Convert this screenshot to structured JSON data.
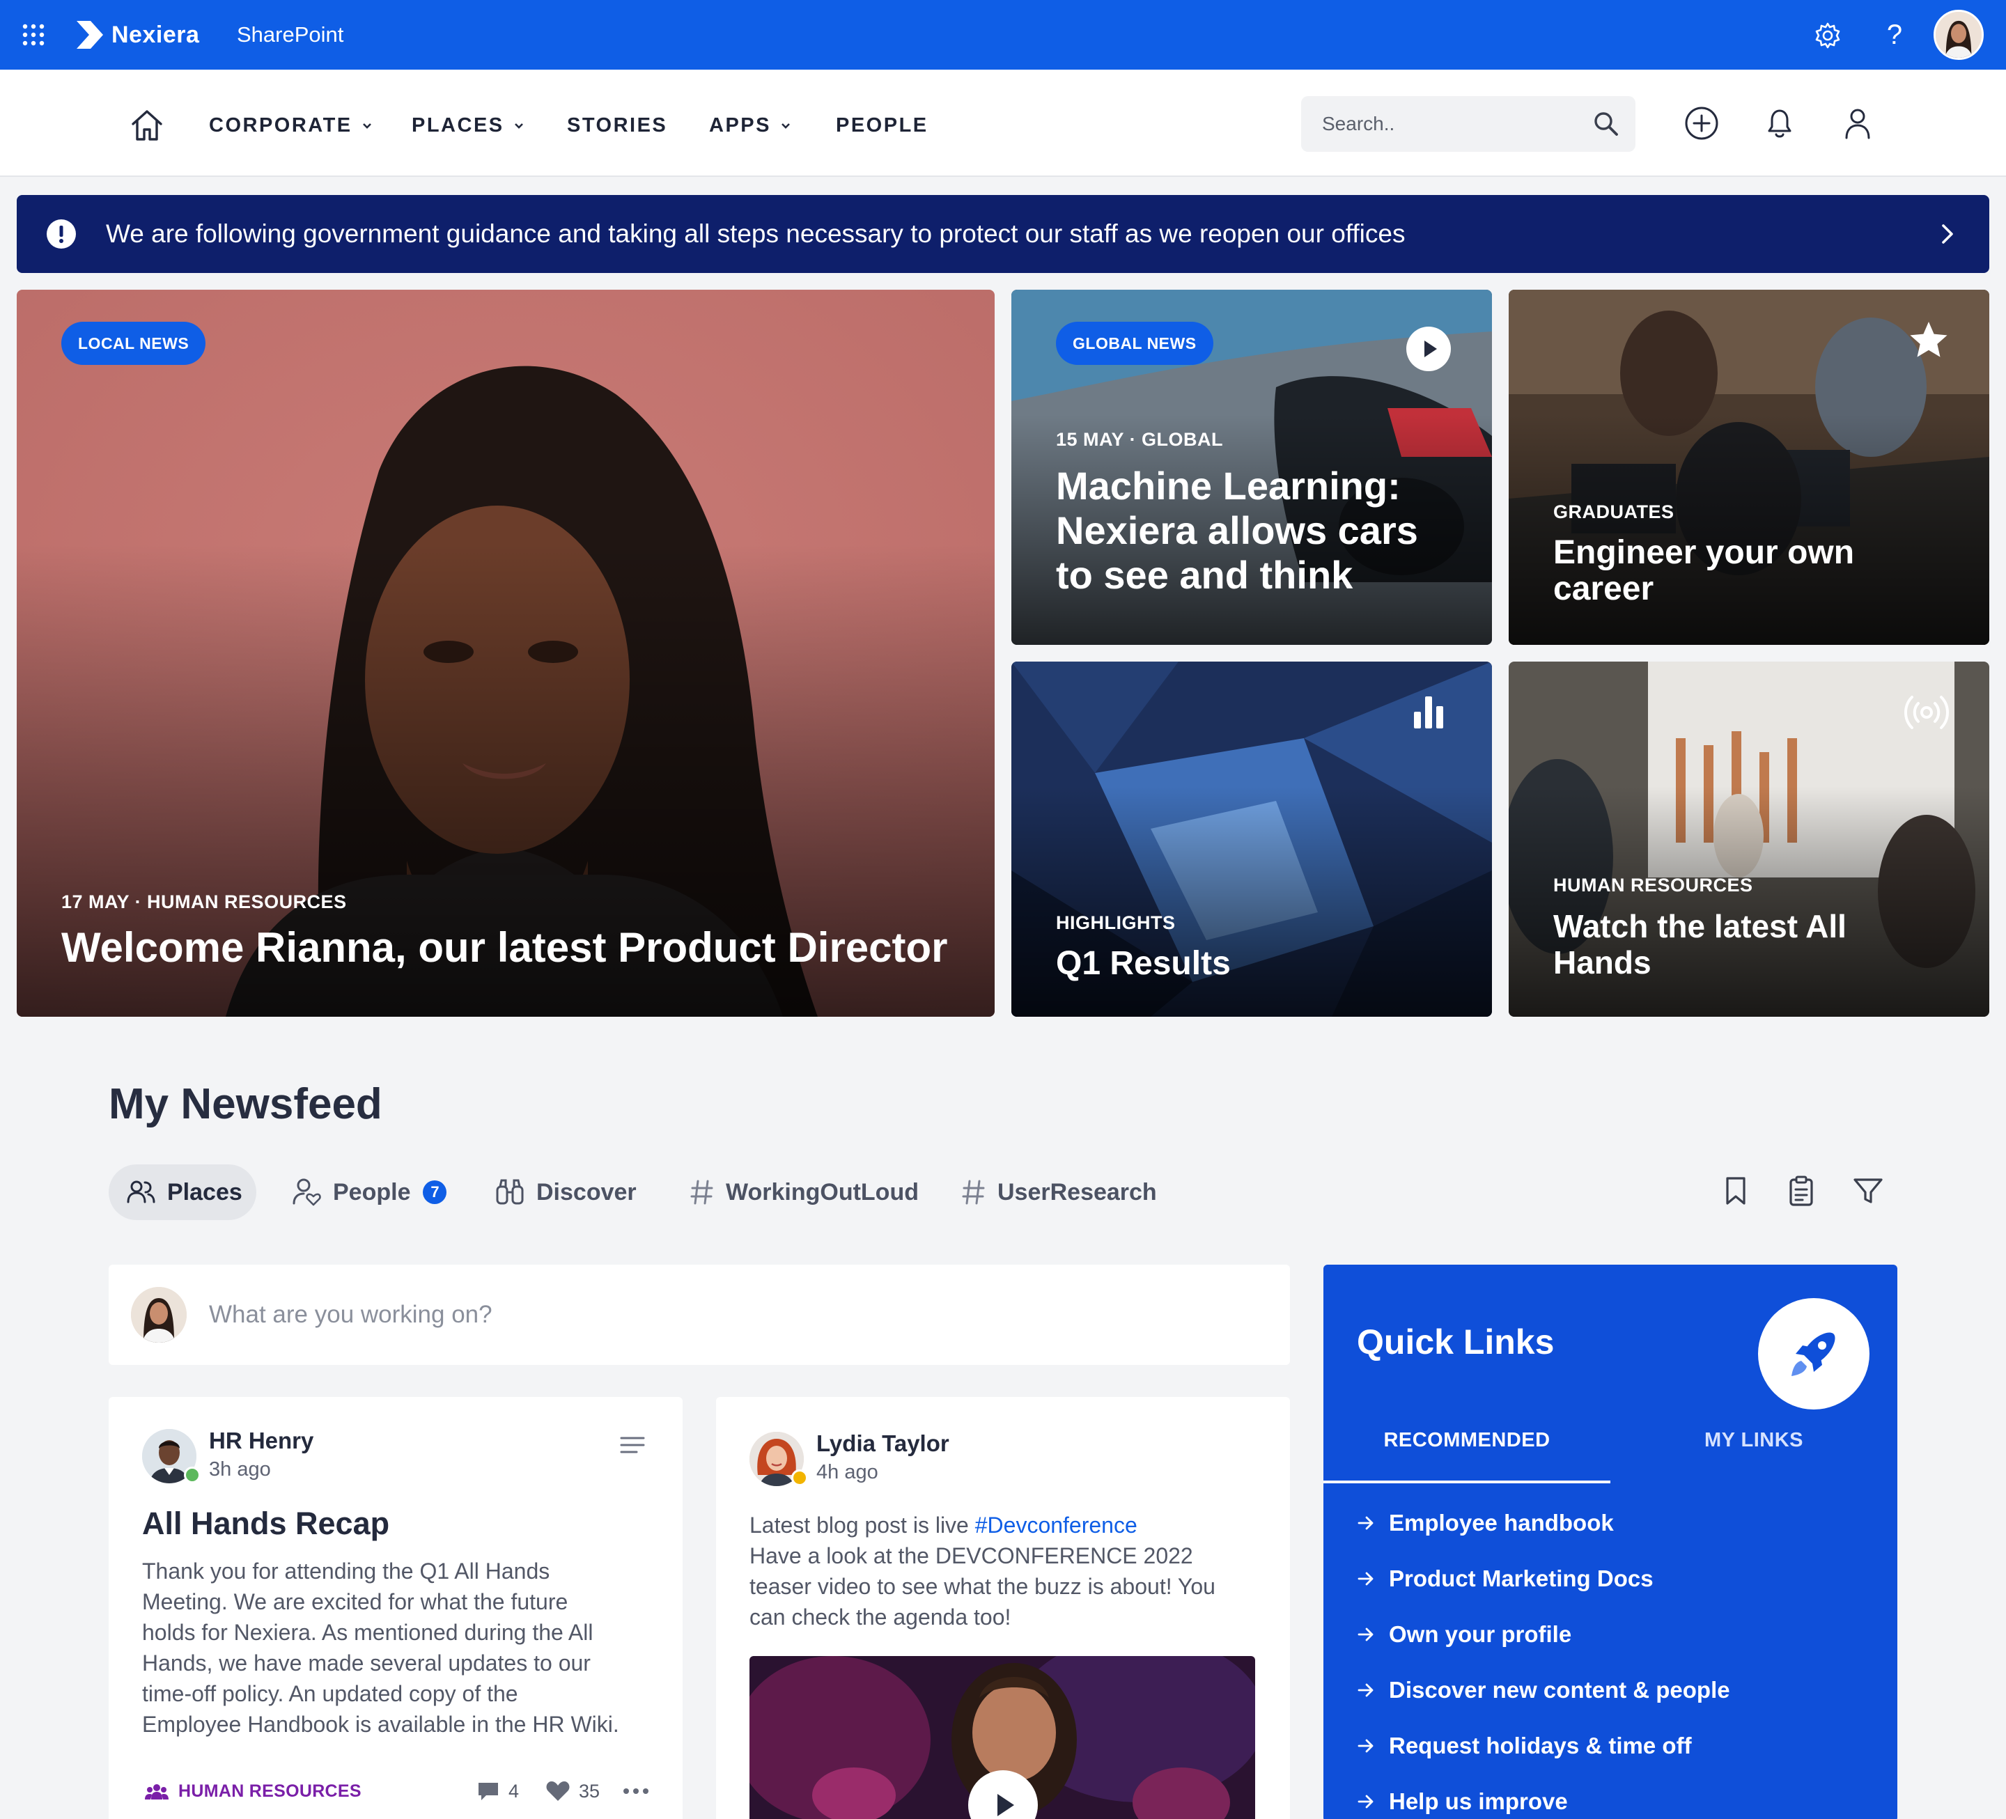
{
  "suite_bar": {
    "brand": "Nexiera",
    "product": "SharePoint",
    "help_glyph": "?"
  },
  "nav": {
    "items": [
      "CORPORATE",
      "PLACES",
      "STORIES",
      "APPS",
      "PEOPLE"
    ],
    "search_placeholder": "Search.."
  },
  "alert": {
    "text": "We are following government guidance and taking all steps necessary to protect our staff as we reopen our offices"
  },
  "hero": {
    "main": {
      "pill": "LOCAL NEWS",
      "meta": "17 MAY · HUMAN RESOURCES",
      "title": "Welcome Rianna, our latest Product Director"
    },
    "ml": {
      "pill": "GLOBAL NEWS",
      "meta": "15 MAY · GLOBAL",
      "title_lines": [
        "Machine Learning:",
        "Nexiera allows cars",
        "to see and think"
      ]
    },
    "grad": {
      "meta": "GRADUATES",
      "title_lines": [
        "Engineer your own",
        "career"
      ]
    },
    "q1": {
      "meta": "HIGHLIGHTS",
      "title": "Q1 Results"
    },
    "allhands": {
      "meta": "HUMAN RESOURCES",
      "title_lines": [
        "Watch the latest All",
        "Hands"
      ]
    }
  },
  "newsfeed": {
    "title": "My Newsfeed",
    "tabs": {
      "places": "Places",
      "people": "People",
      "people_badge": "7",
      "discover": "Discover",
      "working_out_loud": "WorkingOutLoud",
      "user_research": "UserResearch"
    },
    "composer_placeholder": "What are you working on?"
  },
  "posts": [
    {
      "author": "HR Henry",
      "time": "3h ago",
      "heading": "All Hands Recap",
      "body_lines": [
        "Thank you for attending the Q1 All Hands",
        "Meeting. We are excited for what the future",
        "holds for Nexiera. As mentioned during the All",
        "Hands, we have made several updates to our",
        "time-off policy. An updated copy of the",
        "Employee Handbook is available in the HR Wiki."
      ],
      "category": "HUMAN RESOURCES",
      "comments": "4",
      "likes": "35"
    },
    {
      "author": "Lydia Taylor",
      "time": "4h ago",
      "body_first": "Latest blog post is live ",
      "hashtag": "#Devconference",
      "body_lines": [
        "Have a look at the DEVCONFERENCE 2022",
        "teaser video to see what the buzz is about! You",
        "can check the agenda too!"
      ]
    }
  ],
  "quick_links": {
    "title": "Quick Links",
    "tab_recommended": "RECOMMENDED",
    "tab_my_links": "MY LINKS",
    "items": [
      "Employee handbook",
      "Product Marketing Docs",
      "Own your profile",
      "Discover new content & people",
      "Request holidays & time off",
      "Help us improve"
    ]
  },
  "colors": {
    "brand_blue": "#0f5ee6",
    "alert_navy": "#0e1f6b",
    "quick_links_blue": "#0f4fd9",
    "category_purple": "#7a1fa8"
  },
  "icons": [
    "waffle-icon",
    "nexiera-logo-icon",
    "gear-icon",
    "help-icon",
    "home-icon",
    "chevron-down-icon",
    "search-icon",
    "plus-circle-icon",
    "bell-icon",
    "user-icon",
    "alert-exclamation-icon",
    "chevron-right-icon",
    "play-icon",
    "star-icon",
    "bar-chart-icon",
    "broadcast-icon",
    "people-icon",
    "person-heart-icon",
    "binoculars-icon",
    "hashtag-icon",
    "bookmark-icon",
    "clipboard-icon",
    "filter-icon",
    "menu-lines-icon",
    "comment-icon",
    "heart-icon",
    "more-icon",
    "rocket-icon",
    "arrow-right-icon"
  ]
}
